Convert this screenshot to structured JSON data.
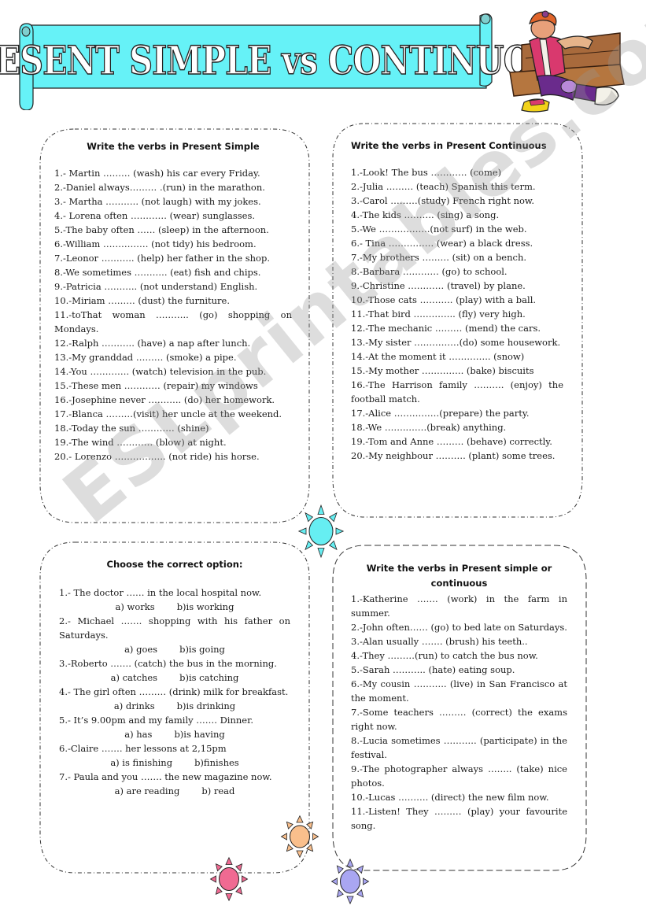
{
  "banner": {
    "title": "PRESENT SIMPLE vs CONTINUOUS",
    "color": "#66f2f7"
  },
  "watermark": "ESLprintables.com",
  "sections": {
    "simple": {
      "title": "Write the verbs in Present Simple",
      "items": [
        "1.- Martin ……… (wash) his car every Friday.",
        "2.-Daniel always……… .(run) in the marathon.",
        "3.- Martha ……….. (not laugh) with my jokes.",
        "4.- Lorena often ………… (wear) sunglasses.",
        "5.-The baby often …… (sleep) in the afternoon.",
        "6.-William …………… (not tidy) his bedroom.",
        "7.-Leonor ……….. (help) her father in the shop.",
        "8.-We sometimes ……….. (eat) fish and chips.",
        "9.-Patricia ……….. (not understand) English.",
        "10.-Miriam ……… (dust) the furniture.",
        "11.-toThat woman ……….. (go) shopping on Mondays.",
        "12.-Ralph ……….. (have) a nap after lunch.",
        "13.-My granddad ……… (smoke) a pipe.",
        "14.-You …………. (watch) television in the pub.",
        "15.-These men ………… (repair) my windows",
        "16.-Josephine never ……….. (do) her homework.",
        "17.-Blanca ………(visit) her uncle at the weekend.",
        "18.-Today the sun ………… (shine)",
        "19.-The wind ………… (blow) at night.",
        "20.- Lorenzo …………….. (not ride) his horse."
      ]
    },
    "continuous": {
      "title": "Write the verbs in Present Continuous",
      "items": [
        "1.-Look! The bus ………… (come)",
        "2.-Julia ……… (teach) Spanish this term.",
        "3.-Carol ………(study) French right now.",
        "4.-The kids ………. (sing) a song.",
        "5.-We ……………..(not surf) in the web.",
        "6.- Tina …………… (wear) a black dress.",
        "7.-My brothers ……… (sit) on a bench.",
        "8.-Barbara ………… (go) to school.",
        "9.-Christine ………… (travel) by plane.",
        "10.-Those cats ……….. (play) with a ball.",
        "11.-That bird ………….. (fly) very high.",
        "12.-The mechanic ……… (mend) the cars.",
        "13.-My sister ……………(do) some housework.",
        "14.-At the moment it ………….. (snow)",
        "15.-My mother ………….. (bake) biscuits",
        "16.-The Harrison family ………. (enjoy) the football match.",
        "17.-Alice ……………(prepare) the party.",
        "18.-We ……..……(break) anything.",
        "19.-Tom and Anne ……… (behave) correctly.",
        "20.-My neighbour ………. (plant) some trees."
      ]
    },
    "choose": {
      "title": "Choose the correct option:",
      "items": [
        {
          "q": "1.- The doctor …… in the local hospital now.",
          "a": "a) works",
          "b": "b)is working"
        },
        {
          "q": "2.- Michael ……. shopping with his father on Saturdays.",
          "a": "a) goes",
          "b": "b)is going"
        },
        {
          "q": "3.-Roberto ……. (catch) the bus in the morning.",
          "a": "a) catches",
          "b": "b)is catching"
        },
        {
          "q": "4.- The girl often ……… (drink) milk for breakfast.",
          "a": "a) drinks",
          "b": "b)is drinking"
        },
        {
          "q": "5.- It’s 9.00pm and my family ……. Dinner.",
          "a": "a) has",
          "b": "b)is having"
        },
        {
          "q": "6.-Claire ……. her lessons at 2,15pm",
          "a": "a) is finishing",
          "b": "b)finishes"
        },
        {
          "q": "7.- Paula and you ……. the new magazine now.",
          "a": "a) are reading",
          "b": "b) read"
        }
      ]
    },
    "mixed": {
      "title": "Write the verbs in Present simple or continuous",
      "items": [
        "1.-Katherine ……. (work) in the farm in summer.",
        "2.-John often…… (go) to bed late on Saturdays.",
        "3.-Alan usually ……. (brush) his teeth..",
        "4.-They ………(run) to catch the bus now.",
        "5.-Sarah ……….. (hate) eating soup.",
        "6.-My cousin ……….. (live) in San Francisco at the moment.",
        "7.-Some teachers ……… (correct) the exams right now.",
        "8.-Lucia sometimes ……….. (participate) in the festival.",
        "9.-The photographer always …….. (take) nice photos.",
        "10.-Lucas ………. (direct) the new film now.",
        "11.-Listen! They ……… (play) your favourite song."
      ]
    }
  },
  "suns": [
    {
      "name": "sun-cyan",
      "color": "#66eef2"
    },
    {
      "name": "sun-orange",
      "color": "#f9bf8c"
    },
    {
      "name": "sun-pink",
      "color": "#f06a92"
    },
    {
      "name": "sun-purple",
      "color": "#a9a6f2"
    }
  ]
}
